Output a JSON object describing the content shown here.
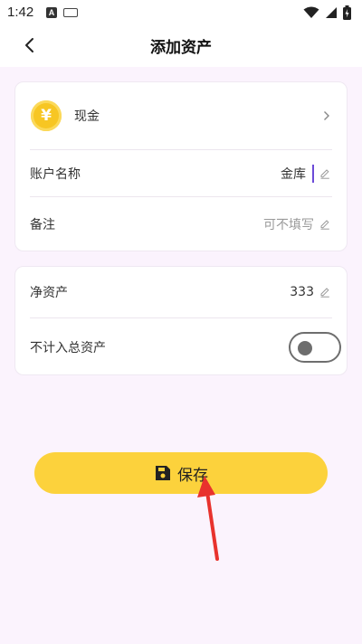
{
  "status_bar": {
    "time": "1:42",
    "notification_letter": "A",
    "icons": [
      "wifi-icon",
      "signal-icon",
      "battery-icon"
    ]
  },
  "header": {
    "title": "添加资产",
    "back_icon": "chevron-left-icon"
  },
  "asset_card": {
    "type_row": {
      "icon": "yuan-coin-icon",
      "icon_glyph": "¥",
      "label": "现金",
      "chevron": "chevron-right-icon"
    },
    "name_row": {
      "label": "账户名称",
      "value": "金库",
      "edit_icon": "pencil-icon"
    },
    "note_row": {
      "label": "备注",
      "placeholder": "可不填写",
      "edit_icon": "pencil-icon"
    }
  },
  "balance_card": {
    "net_row": {
      "label": "净资产",
      "value": "333",
      "edit_icon": "pencil-icon"
    },
    "exclude_row": {
      "label": "不计入总资产",
      "toggle_on": false
    }
  },
  "save_button": {
    "label": "保存",
    "icon": "save-icon"
  },
  "colors": {
    "accent_yellow": "#fcd23c",
    "coin_gold": "#f7c623",
    "page_background": "#fbf3fd",
    "cursor_purple": "#6c4bd8",
    "annotation_red": "#e8322d"
  }
}
